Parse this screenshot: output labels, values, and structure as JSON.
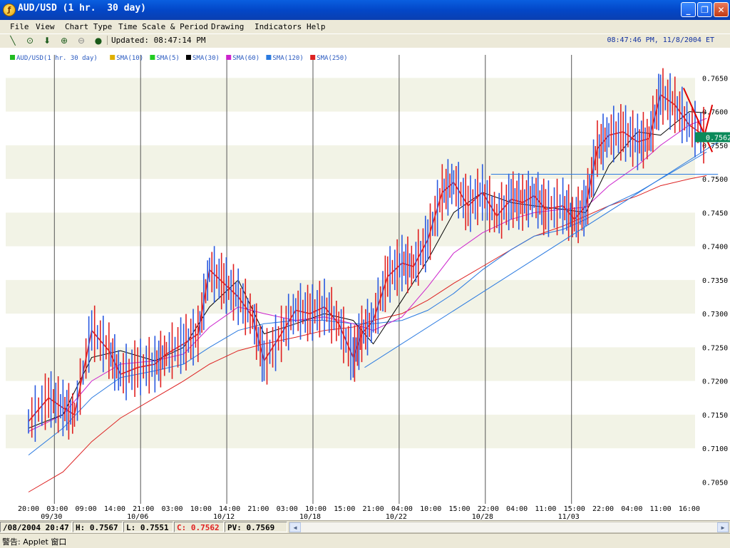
{
  "window": {
    "title": "AUD/USD (1 hr.  30 day)",
    "minimize_icon": "minimize-icon",
    "maximize_icon": "restore-icon",
    "close_icon": "close-icon"
  },
  "menu": [
    "File",
    "View",
    "Chart Type",
    "Time Scale & Period",
    "Drawing",
    "Indicators",
    "Help"
  ],
  "toolbar": {
    "tools": [
      "line-draw-icon",
      "crosshair-icon",
      "arrow-down-icon",
      "zoom-in-icon",
      "zoom-out-icon",
      "color-icon"
    ],
    "updated": "Updated: 08:47:14 PM",
    "clock": "08:47:46 PM, 11/8/2004 ET"
  },
  "legend": [
    {
      "label": "AUD/USD(1 hr.  30 day)",
      "color": "#22bb22"
    },
    {
      "label": "SMA(10)",
      "color": "#e0b000"
    },
    {
      "label": "SMA(5)",
      "color": "#22cc22"
    },
    {
      "label": "SMA(30)",
      "color": "#000000"
    },
    {
      "label": "SMA(60)",
      "color": "#cc22cc"
    },
    {
      "label": "SMA(120)",
      "color": "#2a7ae0"
    },
    {
      "label": "SMA(250)",
      "color": "#dd2222"
    }
  ],
  "price_marker": "0.7562",
  "status": {
    "datetime": "/08/2004 20:47",
    "high": "H: 0.7567",
    "low": "L: 0.7551",
    "close": "C: 0.7562",
    "pv": "PV: 0.7569"
  },
  "applet_bar": "警告: Applet 窗口",
  "chart_data": {
    "type": "line",
    "instrument": "AUD/USD",
    "y_ticks": [
      0.765,
      0.76,
      0.755,
      0.75,
      0.745,
      0.74,
      0.735,
      0.73,
      0.725,
      0.72,
      0.715,
      0.71,
      0.705
    ],
    "ylim": [
      0.7025,
      0.768
    ],
    "x_time_labels": [
      "20:00",
      "03:00",
      "09:00",
      "14:00",
      "21:00",
      "03:00",
      "10:00",
      "14:00",
      "21:00",
      "03:00",
      "10:00",
      "15:00",
      "21:00",
      "04:00",
      "10:00",
      "15:00",
      "22:00",
      "04:00",
      "11:00",
      "15:00",
      "22:00",
      "04:00",
      "11:00",
      "16:00"
    ],
    "x_date_labels": [
      {
        "label": "09/30",
        "at": 1
      },
      {
        "label": "10/06",
        "at": 4
      },
      {
        "label": "10/12",
        "at": 7
      },
      {
        "label": "10/18",
        "at": 10
      },
      {
        "label": "10/22",
        "at": 13
      },
      {
        "label": "10/28",
        "at": 16
      },
      {
        "label": "11/03",
        "at": 19
      }
    ],
    "series": [
      {
        "name": "AUD/USD(1 hr.  30 day)",
        "color": "#e02020",
        "x": [
          0,
          0.7,
          1.2,
          1.6,
          2.2,
          2.8,
          3.2,
          3.8,
          4.4,
          4.8,
          5.4,
          5.9,
          6.3,
          6.8,
          7.3,
          7.8,
          8.2,
          8.8,
          9.3,
          9.8,
          10.3,
          10.8,
          11.3,
          11.6,
          12.0,
          12.5,
          13.0,
          13.4,
          13.9,
          14.4,
          14.8,
          15.3,
          15.8,
          16.3,
          16.8,
          17.2,
          17.6,
          18.0,
          18.6,
          19.0,
          19.4,
          19.8,
          20.2,
          20.7,
          21.2,
          21.6,
          22.0,
          22.5,
          23.0,
          23.6
        ],
        "y": [
          0.714,
          0.7175,
          0.716,
          0.715,
          0.7275,
          0.7245,
          0.721,
          0.722,
          0.7225,
          0.724,
          0.7255,
          0.727,
          0.7365,
          0.7345,
          0.7325,
          0.7295,
          0.723,
          0.727,
          0.7305,
          0.73,
          0.731,
          0.7285,
          0.7235,
          0.727,
          0.729,
          0.7355,
          0.7375,
          0.737,
          0.741,
          0.748,
          0.7495,
          0.746,
          0.748,
          0.7445,
          0.747,
          0.7465,
          0.7475,
          0.7455,
          0.746,
          0.744,
          0.746,
          0.7545,
          0.7565,
          0.757,
          0.7555,
          0.756,
          0.7625,
          0.761,
          0.758,
          0.7562
        ]
      },
      {
        "name": "SMA(30)",
        "color": "#000000",
        "x": [
          0,
          1.2,
          2.2,
          3.2,
          4.4,
          5.4,
          6.3,
          7.3,
          8.2,
          9.3,
          10.3,
          11.3,
          12.0,
          13.0,
          13.9,
          14.8,
          15.8,
          16.8,
          17.6,
          18.6,
          19.4,
          20.2,
          21.2,
          22.0,
          23.0,
          23.6
        ],
        "y": [
          0.713,
          0.715,
          0.7235,
          0.7245,
          0.723,
          0.725,
          0.731,
          0.735,
          0.727,
          0.7285,
          0.73,
          0.729,
          0.7255,
          0.732,
          0.738,
          0.745,
          0.748,
          0.7465,
          0.746,
          0.7455,
          0.745,
          0.752,
          0.757,
          0.7565,
          0.76,
          0.7598
        ]
      },
      {
        "name": "SMA(60)",
        "color": "#cc22cc",
        "x": [
          0,
          1.2,
          2.2,
          3.2,
          4.4,
          5.4,
          6.3,
          7.3,
          8.2,
          9.3,
          10.3,
          11.3,
          12.0,
          13.0,
          13.9,
          14.8,
          15.8,
          16.8,
          17.6,
          18.6,
          19.4,
          20.2,
          21.2,
          22.0,
          23.0,
          23.6
        ],
        "y": [
          0.7125,
          0.715,
          0.72,
          0.7225,
          0.723,
          0.724,
          0.728,
          0.731,
          0.73,
          0.729,
          0.7295,
          0.7285,
          0.7275,
          0.7295,
          0.734,
          0.739,
          0.742,
          0.744,
          0.745,
          0.7455,
          0.7458,
          0.749,
          0.752,
          0.755,
          0.758,
          0.759
        ]
      },
      {
        "name": "SMA(120)",
        "color": "#2a7ae0",
        "x": [
          0,
          1.2,
          2.2,
          3.2,
          4.4,
          5.4,
          6.3,
          7.3,
          8.2,
          9.3,
          10.3,
          11.3,
          12.0,
          13.0,
          13.9,
          14.8,
          15.8,
          16.8,
          17.6,
          18.6,
          19.4,
          20.2,
          21.2,
          22.0,
          23.0,
          23.6
        ],
        "y": [
          0.709,
          0.713,
          0.7175,
          0.7205,
          0.7215,
          0.7225,
          0.725,
          0.7275,
          0.7285,
          0.729,
          0.729,
          0.7285,
          0.7285,
          0.729,
          0.7305,
          0.733,
          0.7365,
          0.7395,
          0.7415,
          0.7425,
          0.744,
          0.746,
          0.748,
          0.75,
          0.7525,
          0.754
        ]
      },
      {
        "name": "SMA(250)",
        "color": "#dd2222",
        "x": [
          0,
          1.2,
          2.2,
          3.2,
          4.4,
          5.4,
          6.3,
          7.3,
          8.2,
          9.3,
          10.3,
          11.3,
          12.0,
          13.0,
          13.9,
          14.8,
          15.8,
          16.8,
          17.6,
          18.6,
          19.4,
          20.2,
          21.2,
          22.0,
          23.0,
          23.6
        ],
        "y": [
          0.7035,
          0.7065,
          0.711,
          0.7145,
          0.7175,
          0.72,
          0.7225,
          0.7245,
          0.7255,
          0.7265,
          0.7275,
          0.728,
          0.729,
          0.73,
          0.732,
          0.7345,
          0.737,
          0.7395,
          0.7415,
          0.743,
          0.7445,
          0.746,
          0.7475,
          0.749,
          0.75,
          0.7505
        ]
      }
    ],
    "trendlines": [
      {
        "color": "#2a7ae0",
        "from": [
          11.7,
          0.722
        ],
        "to": [
          24.0,
          0.7555
        ]
      },
      {
        "color": "#2a7ae0",
        "from": [
          16.1,
          0.7507
        ],
        "to": [
          24.0,
          0.7507
        ]
      }
    ],
    "grid": "horizontal bands",
    "price_axis": "right"
  }
}
